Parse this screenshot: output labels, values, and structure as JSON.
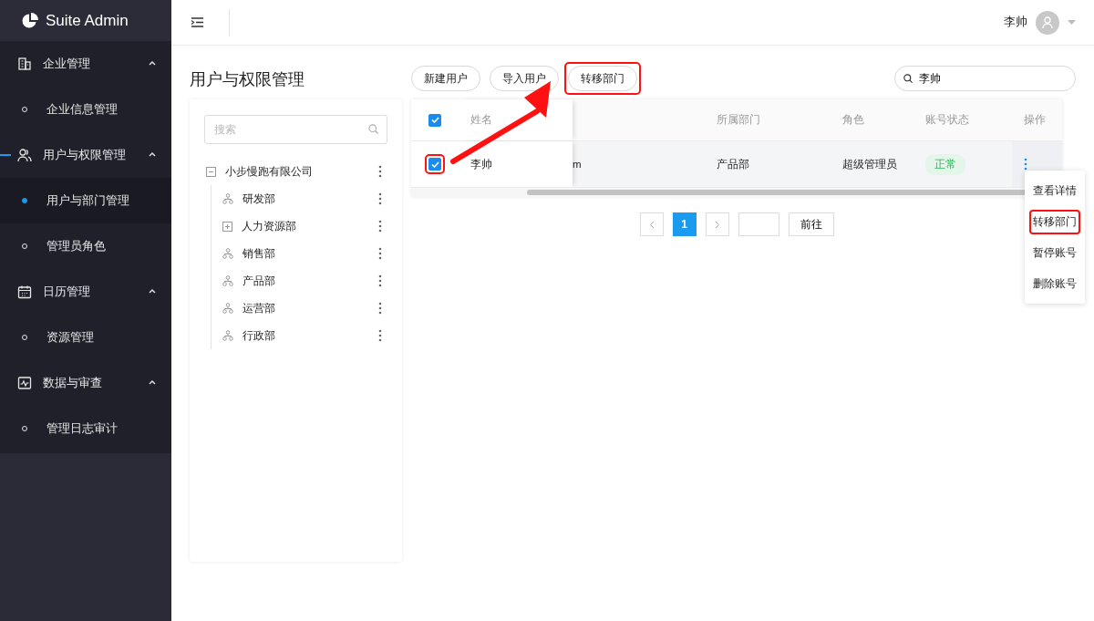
{
  "app": {
    "logo": "Suite Admin"
  },
  "sidebar": {
    "groups": [
      {
        "label": "企业管理",
        "expanded": true,
        "active": false,
        "children": [
          {
            "label": "企业信息管理",
            "selected": false
          }
        ]
      },
      {
        "label": "用户与权限管理",
        "expanded": true,
        "active": true,
        "children": [
          {
            "label": "用户与部门管理",
            "selected": true
          },
          {
            "label": "管理员角色",
            "selected": false
          }
        ]
      },
      {
        "label": "日历管理",
        "expanded": true,
        "active": false,
        "children": [
          {
            "label": "资源管理",
            "selected": false
          }
        ]
      },
      {
        "label": "数据与审查",
        "expanded": true,
        "active": false,
        "children": [
          {
            "label": "管理日志审计",
            "selected": false
          }
        ]
      }
    ]
  },
  "header": {
    "user_name": "李帅"
  },
  "page": {
    "title": "用户与权限管理"
  },
  "tree": {
    "search_placeholder": "搜索",
    "root": {
      "label": "小步慢跑有限公司",
      "expanded": true,
      "children": [
        {
          "label": "研发部",
          "kind": "leaf"
        },
        {
          "label": "人力资源部",
          "kind": "collapsed"
        },
        {
          "label": "销售部",
          "kind": "leaf"
        },
        {
          "label": "产品部",
          "kind": "leaf"
        },
        {
          "label": "运营部",
          "kind": "leaf"
        },
        {
          "label": "行政部",
          "kind": "leaf"
        }
      ]
    }
  },
  "toolbar": {
    "buttons": [
      {
        "label": "新建用户",
        "highlighted": false
      },
      {
        "label": "导入用户",
        "highlighted": false
      },
      {
        "label": "转移部门",
        "highlighted": true
      }
    ],
    "search_value": "李帅"
  },
  "table": {
    "header_checked": true,
    "columns": {
      "name": "姓名",
      "department": "所属部门",
      "role": "角色",
      "status": "账号状态",
      "actions": "操作"
    },
    "rows": [
      {
        "checked": true,
        "highlighted": true,
        "name": "李帅",
        "column_3": "m",
        "department": "产品部",
        "role": "超级管理员",
        "status": "正常"
      }
    ]
  },
  "actions_menu": {
    "items": [
      {
        "label": "查看详情",
        "highlighted": false
      },
      {
        "label": "转移部门",
        "highlighted": true
      },
      {
        "label": "暂停账号",
        "highlighted": false
      },
      {
        "label": "删除账号",
        "highlighted": false
      }
    ]
  },
  "pagination": {
    "pages": [
      {
        "label": "1",
        "selected": true
      }
    ],
    "goto_button": "前往"
  }
}
